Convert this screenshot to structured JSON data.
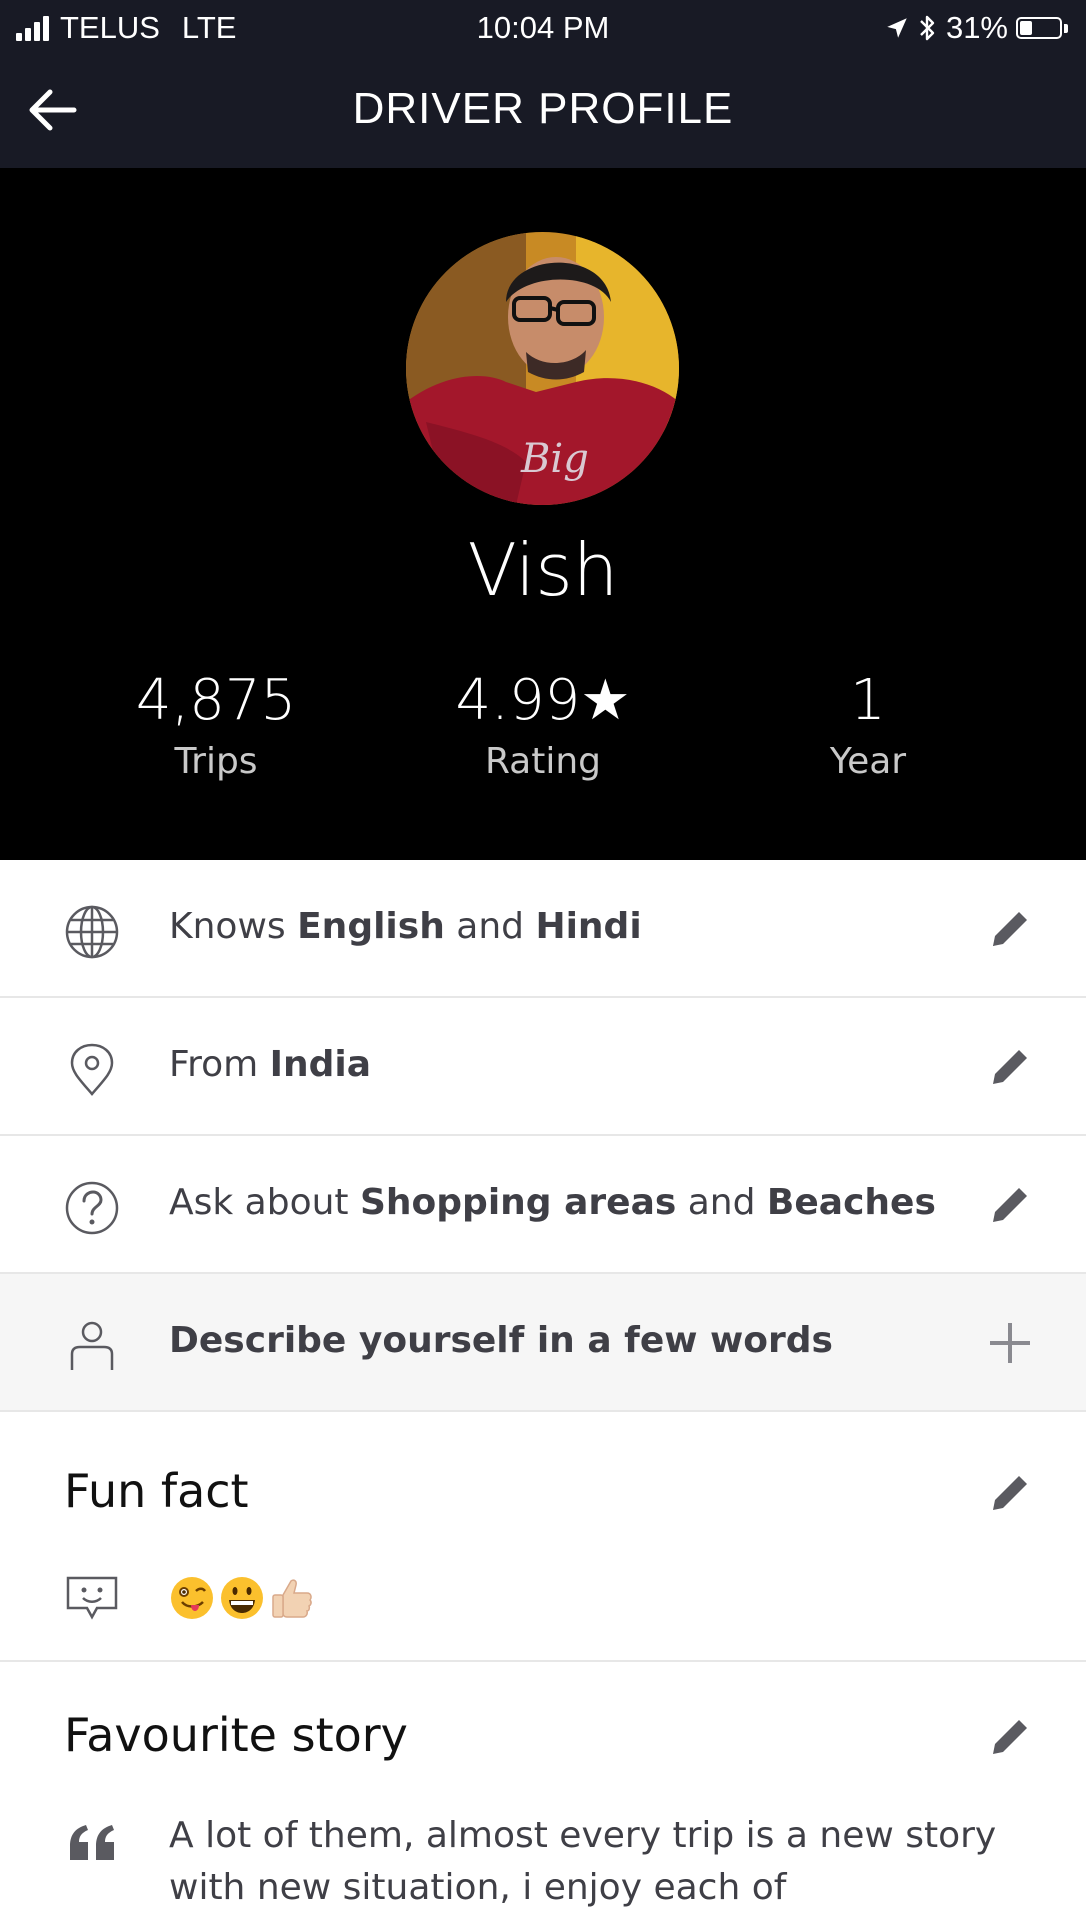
{
  "status_bar": {
    "carrier": "TELUS",
    "network": "LTE",
    "time": "10:04 PM",
    "battery": "31%",
    "battery_level": 0.31,
    "icons": [
      "signal-bars-icon",
      "location-arrow-icon",
      "bluetooth-icon",
      "battery-icon"
    ]
  },
  "nav": {
    "title": "DRIVER PROFILE",
    "back_icon": "back-arrow-icon"
  },
  "profile": {
    "name": "Vish",
    "stats": [
      {
        "value": "4,875",
        "label": "Trips"
      },
      {
        "value": "4.99★",
        "label": "Rating"
      },
      {
        "value": "1",
        "label": "Year"
      }
    ]
  },
  "details": {
    "languages": {
      "prefix": "Knows ",
      "first": "English",
      "joiner": " and ",
      "second": "Hindi",
      "icon": "globe-icon"
    },
    "origin": {
      "prefix": "From ",
      "value": "India",
      "icon": "location-pin-icon"
    },
    "ask_about": {
      "prefix": "Ask about ",
      "first": "Shopping areas",
      "joiner": " and ",
      "second": "Beaches",
      "icon": "question-circle-icon"
    },
    "describe": {
      "label": "Describe yourself in a few words",
      "icon": "person-icon",
      "action_icon": "plus-icon"
    }
  },
  "fun_fact": {
    "title": "Fun fact",
    "icon": "chat-smile-icon",
    "emojis": [
      "winking-tongue-emoji",
      "grinning-emoji",
      "thumbs-up-emoji"
    ]
  },
  "favourite_story": {
    "title": "Favourite story",
    "icon": "quote-icon",
    "text": "A lot of them, almost every trip is a new story with new situation, i enjoy each of"
  },
  "colors": {
    "header_bg": "#181a25",
    "hero_bg": "#000000",
    "row_alt_bg": "#f6f6f6",
    "body_text": "#3f3f46",
    "icon_gray": "#5a5a60"
  }
}
